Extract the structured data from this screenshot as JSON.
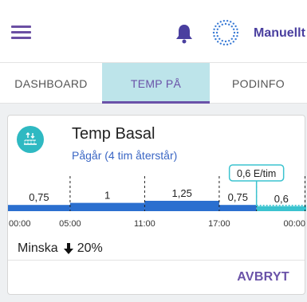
{
  "header": {
    "mode_label": "Manuellt",
    "menu_icon": "hamburger-menu-icon",
    "notification_icon": "bell-icon",
    "pod_icon": "pod-status-icon"
  },
  "tabs": [
    {
      "label": "DASHBOARD",
      "active": false
    },
    {
      "label": "TEMP PÅ",
      "active": true
    },
    {
      "label": "PODINFO",
      "active": false
    }
  ],
  "temp_basal": {
    "title": "Temp Basal",
    "status": "Pågår (4 tim återstår)",
    "icon": "temp-basal-icon",
    "current_rate_callout": "0,6 E/tim",
    "adjustment_label": "Minska",
    "adjustment_value": "20%",
    "adjustment_icon": "arrow-down-icon",
    "cancel_label": "AVBRYT"
  },
  "chart_data": {
    "type": "bar",
    "x_ticks": [
      "00:00",
      "05:00",
      "11:00",
      "17:00",
      "00:00"
    ],
    "segments": [
      {
        "start": "00:00",
        "end": "05:00",
        "value": 0.75,
        "label": "0,75",
        "temp": false
      },
      {
        "start": "05:00",
        "end": "11:00",
        "value": 1,
        "label": "1",
        "temp": false
      },
      {
        "start": "11:00",
        "end": "17:00",
        "value": 1.25,
        "label": "1,25",
        "temp": false
      },
      {
        "start": "17:00",
        "end": "20:00",
        "value": 0.75,
        "label": "0,75",
        "temp": false
      },
      {
        "start": "20:00",
        "end": "24:00",
        "value": 0.6,
        "label": "0,6",
        "temp": true
      }
    ],
    "colors": {
      "scheduled": "#2b6fcf",
      "temp": "#3bc3cf"
    }
  }
}
